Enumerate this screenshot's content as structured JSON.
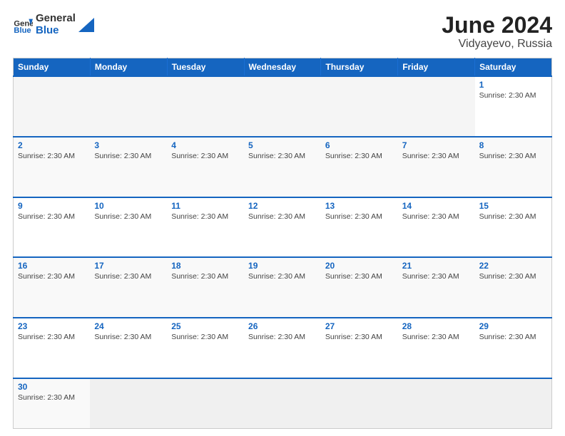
{
  "header": {
    "logo_general": "General",
    "logo_blue": "Blue",
    "month_title": "June 2024",
    "location": "Vidyayevo, Russia"
  },
  "days_of_week": [
    "Sunday",
    "Monday",
    "Tuesday",
    "Wednesday",
    "Thursday",
    "Friday",
    "Saturday"
  ],
  "sunrise_text": "Sunrise: 2:30 AM",
  "weeks": [
    [
      {
        "day": "",
        "empty": true
      },
      {
        "day": "",
        "empty": true
      },
      {
        "day": "",
        "empty": true
      },
      {
        "day": "",
        "empty": true
      },
      {
        "day": "",
        "empty": true
      },
      {
        "day": "",
        "empty": true
      },
      {
        "day": "1",
        "empty": false
      }
    ],
    [
      {
        "day": "2",
        "empty": false
      },
      {
        "day": "3",
        "empty": false
      },
      {
        "day": "4",
        "empty": false
      },
      {
        "day": "5",
        "empty": false
      },
      {
        "day": "6",
        "empty": false
      },
      {
        "day": "7",
        "empty": false
      },
      {
        "day": "8",
        "empty": false
      }
    ],
    [
      {
        "day": "9",
        "empty": false
      },
      {
        "day": "10",
        "empty": false
      },
      {
        "day": "11",
        "empty": false
      },
      {
        "day": "12",
        "empty": false
      },
      {
        "day": "13",
        "empty": false
      },
      {
        "day": "14",
        "empty": false
      },
      {
        "day": "15",
        "empty": false
      }
    ],
    [
      {
        "day": "16",
        "empty": false
      },
      {
        "day": "17",
        "empty": false
      },
      {
        "day": "18",
        "empty": false
      },
      {
        "day": "19",
        "empty": false
      },
      {
        "day": "20",
        "empty": false
      },
      {
        "day": "21",
        "empty": false
      },
      {
        "day": "22",
        "empty": false
      }
    ],
    [
      {
        "day": "23",
        "empty": false
      },
      {
        "day": "24",
        "empty": false
      },
      {
        "day": "25",
        "empty": false
      },
      {
        "day": "26",
        "empty": false
      },
      {
        "day": "27",
        "empty": false
      },
      {
        "day": "28",
        "empty": false
      },
      {
        "day": "29",
        "empty": false
      }
    ],
    [
      {
        "day": "30",
        "empty": false
      },
      {
        "day": "",
        "empty": true
      },
      {
        "day": "",
        "empty": true
      },
      {
        "day": "",
        "empty": true
      },
      {
        "day": "",
        "empty": true
      },
      {
        "day": "",
        "empty": true
      },
      {
        "day": "",
        "empty": true
      }
    ]
  ]
}
